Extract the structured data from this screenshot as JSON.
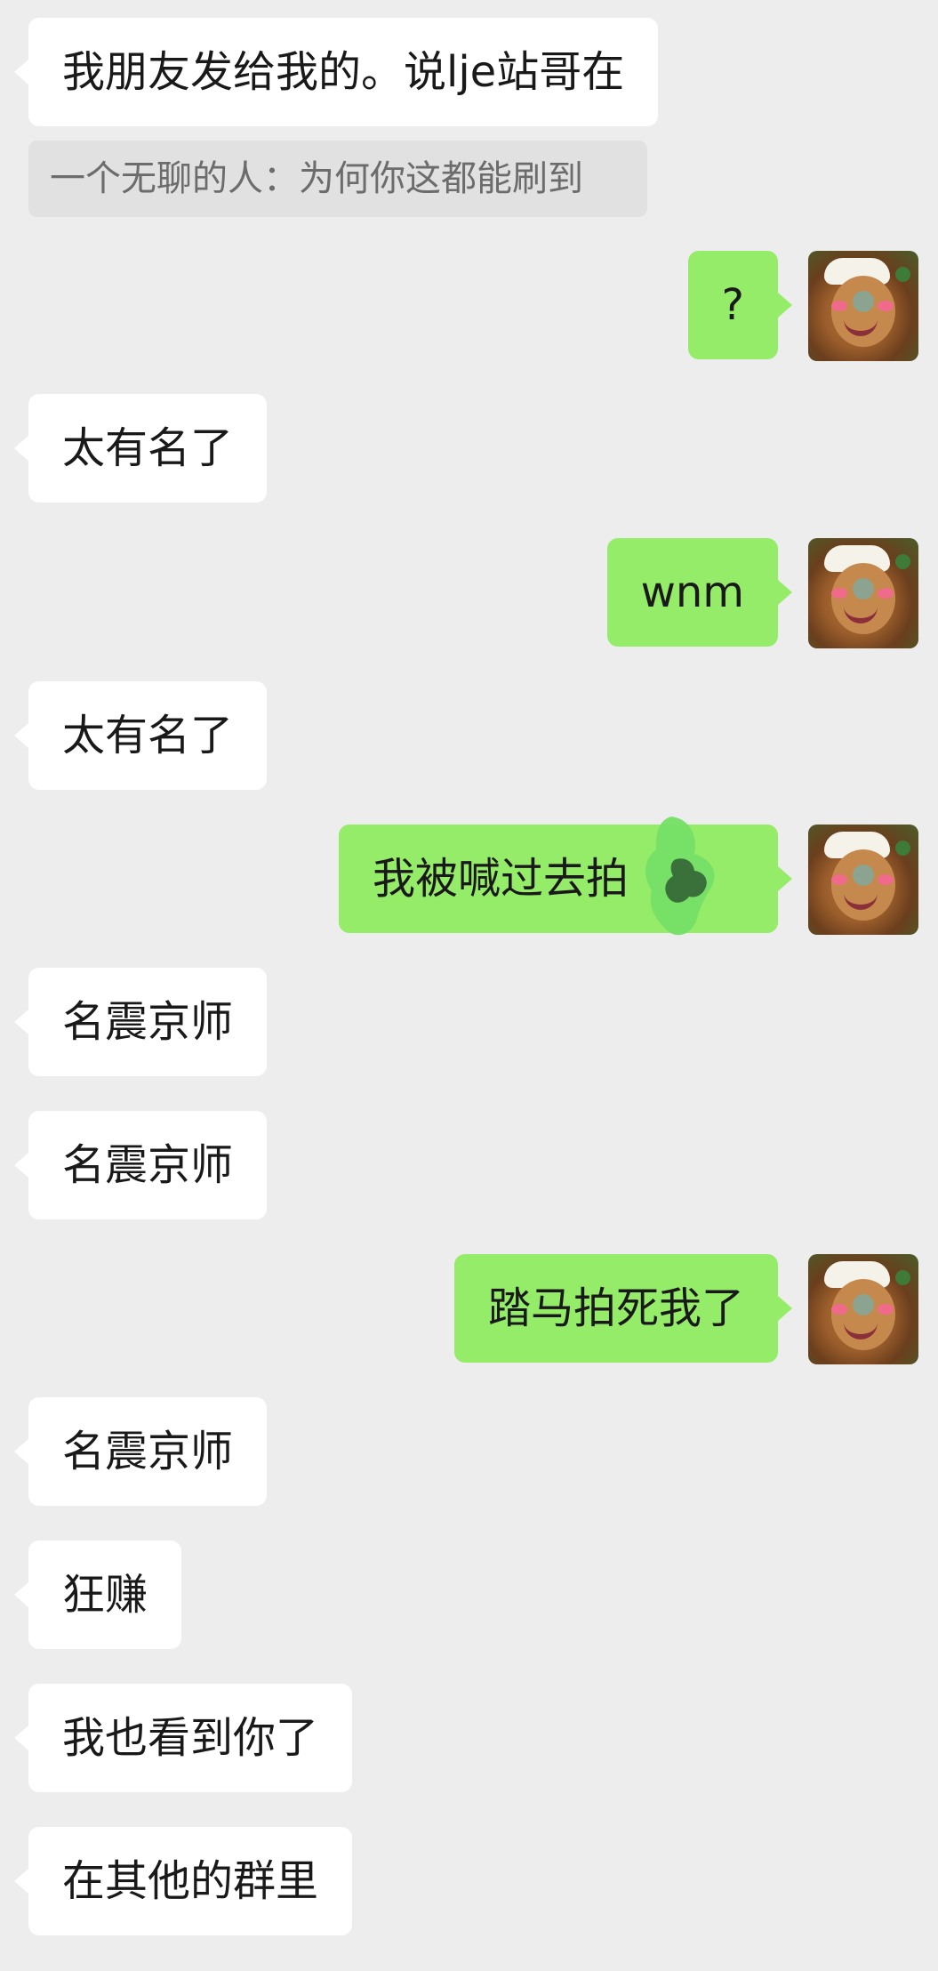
{
  "chat": {
    "messages": [
      {
        "sender": "other",
        "text": "我朋友发给我的。说lje站哥在"
      },
      {
        "sender": "other",
        "text": "太有名了"
      },
      {
        "sender": "other",
        "text": "太有名了"
      },
      {
        "sender": "other",
        "text": "名震京师"
      },
      {
        "sender": "other",
        "text": "名震京师"
      },
      {
        "sender": "other",
        "text": "名震京师"
      },
      {
        "sender": "other",
        "text": "狂赚"
      },
      {
        "sender": "other",
        "text": "我也看到你了"
      },
      {
        "sender": "other",
        "text": "在其他的群里"
      },
      {
        "sender": "self",
        "text": "?"
      },
      {
        "sender": "self",
        "text": "wnm"
      },
      {
        "sender": "self",
        "text": "我被喊过去拍"
      },
      {
        "sender": "self",
        "text": "踏马拍死我了"
      }
    ],
    "quote_text": "一个无聊的人：为何你这都能刷到",
    "avatar": {
      "icon": "cartoon-character-avatar-icon"
    },
    "colors": {
      "background": "#ededed",
      "incoming_bubble": "#ffffff",
      "outgoing_bubble": "#95ec69",
      "quote_bubble": "#e1e1e1",
      "text": "#191919"
    }
  }
}
